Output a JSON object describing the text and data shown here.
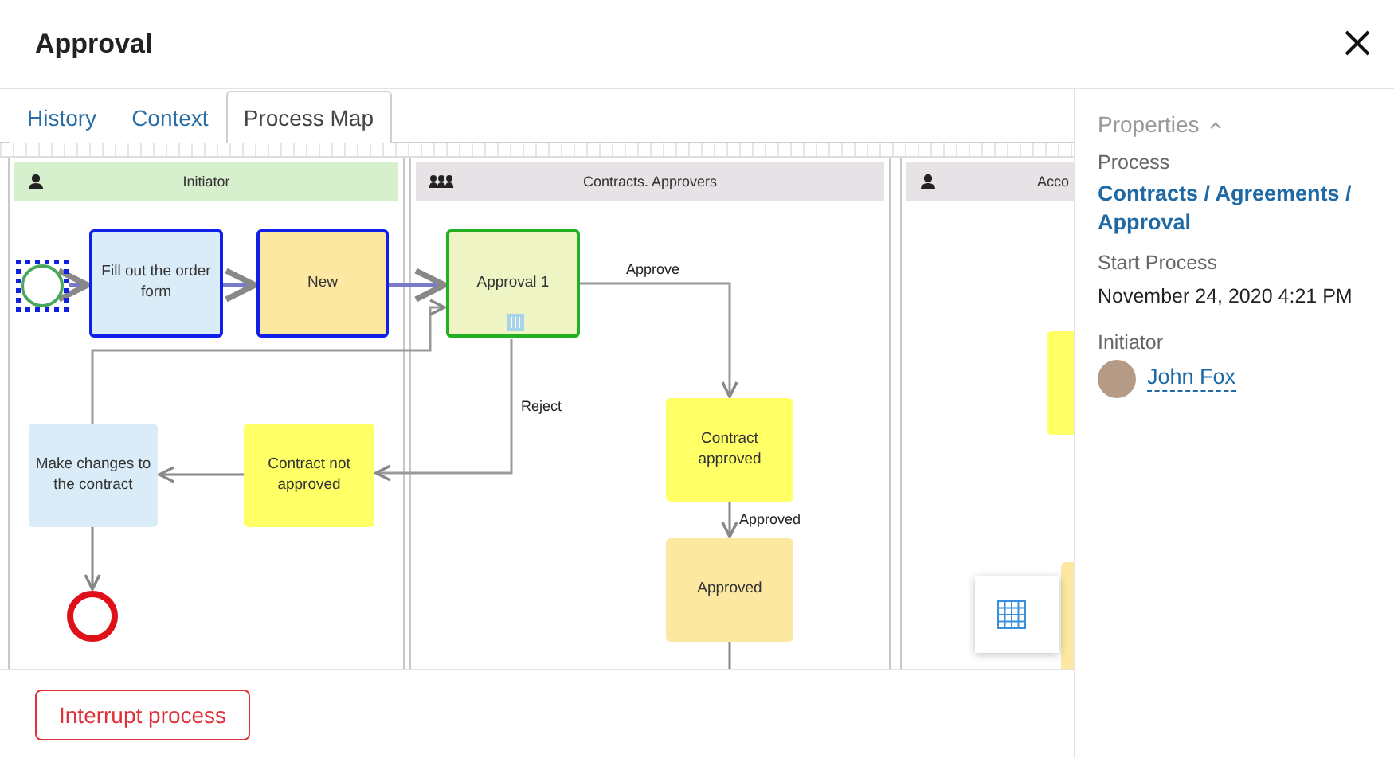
{
  "window": {
    "title": "Approval"
  },
  "tabs": [
    {
      "label": "History",
      "selected": false
    },
    {
      "label": "Context",
      "selected": false
    },
    {
      "label": "Process Map",
      "selected": true
    }
  ],
  "lanes": [
    {
      "title": "Initiator",
      "kind": "person",
      "color": "#d6efcc"
    },
    {
      "title": "Contracts. Approvers",
      "kind": "group",
      "color": "#e6e2e6"
    },
    {
      "title": "Acco",
      "kind": "person",
      "color": "#e6e2e6"
    }
  ],
  "nodes": [
    {
      "kind": "start",
      "selected": true
    },
    {
      "kind": "task",
      "label": "Fill out the order form",
      "color": "#d9ecf7",
      "completed": true,
      "current": false
    },
    {
      "kind": "task",
      "label": "New",
      "color": "#fce8a0",
      "completed": true,
      "current": false
    },
    {
      "kind": "task",
      "label": "Approval 1",
      "color": "#eef4c4",
      "completed": false,
      "current": true
    },
    {
      "kind": "task",
      "label": "Make changes to the contract",
      "color": "#d9ecf7",
      "completed": false,
      "current": false
    },
    {
      "kind": "task",
      "label": "Contract not approved",
      "color": "#ffff66",
      "completed": false,
      "current": false
    },
    {
      "kind": "end"
    },
    {
      "kind": "task",
      "label": "Contract approved",
      "color": "#ffff66",
      "completed": false,
      "current": false
    },
    {
      "kind": "task",
      "label": "Approved",
      "color": "#fce8a0",
      "completed": false,
      "current": false
    },
    {
      "kind": "task",
      "color": "#ffff66",
      "completed": false,
      "current": false
    },
    {
      "kind": "task",
      "color": "#fce8a0",
      "completed": false,
      "current": false
    }
  ],
  "edge_labels": [
    "Approve",
    "Reject",
    "Approved"
  ],
  "properties": {
    "heading": "Properties",
    "fields": [
      {
        "label": "Process",
        "value": "Contracts / Agreements / Approval",
        "kind": "link"
      },
      {
        "label": "Start Process",
        "value": "November 24, 2020 4:21 PM",
        "kind": "text"
      },
      {
        "label": "Initiator",
        "value": "John Fox",
        "kind": "user"
      }
    ]
  },
  "footer": {
    "button": "Interrupt process"
  }
}
